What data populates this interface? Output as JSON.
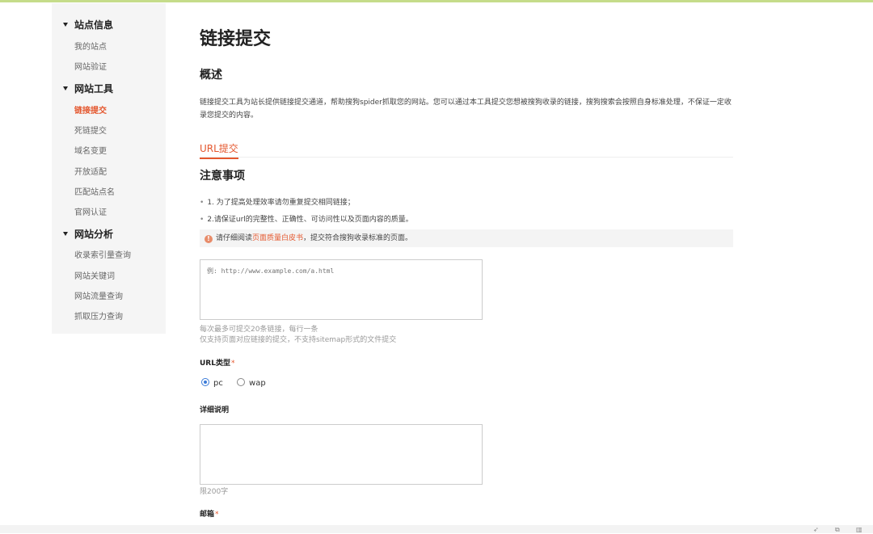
{
  "sidebar": {
    "groups": [
      {
        "label": "站点信息",
        "items": [
          "我的站点",
          "网站验证"
        ]
      },
      {
        "label": "网站工具",
        "items": [
          "链接提交",
          "死链提交",
          "域名变更",
          "开放适配",
          "匹配站点名",
          "官网认证"
        ]
      },
      {
        "label": "网站分析",
        "items": [
          "收录索引量查询",
          "网站关键词",
          "网站流量查询",
          "抓取压力查询"
        ]
      }
    ],
    "active_item": "链接提交"
  },
  "main": {
    "title": "链接提交",
    "overview_heading": "概述",
    "description": "链接提交工具为站长提供链接提交通道，帮助搜狗spider抓取您的网站。您可以通过本工具提交您想被搜狗收录的链接，搜狗搜索会按照自身标准处理，不保证一定收录您提交的内容。",
    "tab_label": "URL提交",
    "notes_heading": "注意事项",
    "notes": [
      "1. 为了提高处理效率请勿重复提交相同链接；",
      "2.请保证url的完整性、正确性、可访问性以及页面内容的质量。"
    ],
    "warning": {
      "prefix": "请仔细阅读",
      "link": "页面质量白皮书",
      "suffix": "，提交符合搜狗收录标准的页面。",
      "icon": "exclamation-icon"
    },
    "url_textarea_placeholder": "例: http://www.example.com/a.html",
    "url_hint_1": "每次最多可提交20条链接，每行一条",
    "url_hint_2": "仅支持页面对应链接的提交，不支持sitemap形式的文件提交",
    "url_type_label": "URL类型",
    "url_type_options": [
      "pc",
      "wap"
    ],
    "url_type_selected": "pc",
    "detail_label": "详细说明",
    "detail_limit": "限200字",
    "email_label": "邮箱",
    "required_mark": "*"
  },
  "colors": {
    "accent": "#e4572e",
    "top_bar": "#c5dc8a",
    "radio": "#3b7bd8"
  },
  "bottom_icons": [
    "rocket-icon",
    "copy-icon",
    "trash-icon"
  ]
}
